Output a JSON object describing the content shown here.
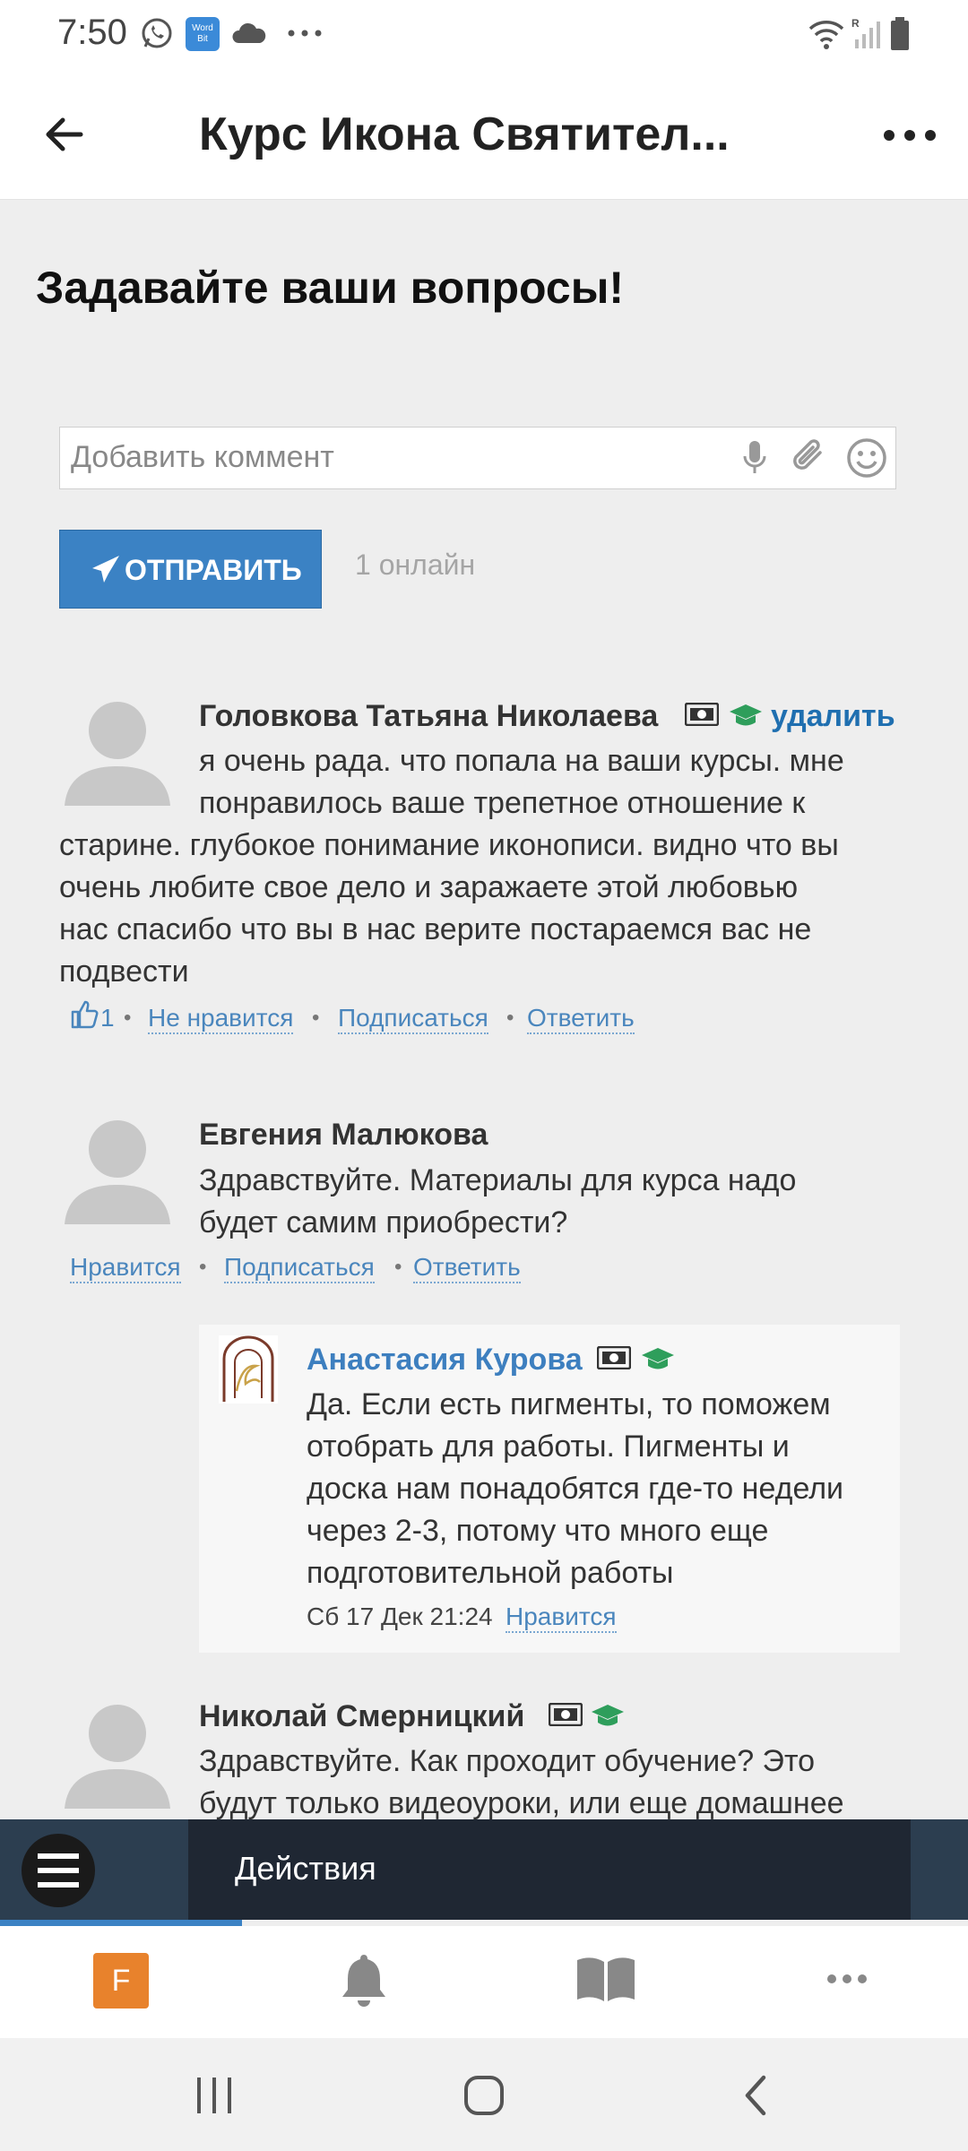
{
  "status_bar": {
    "time": "7:50",
    "icons": [
      "whatsapp-icon",
      "wordbit-icon",
      "cloud-icon",
      "more-dots-icon",
      "wifi-icon",
      "signal-icon",
      "battery-icon"
    ]
  },
  "header": {
    "title": "Курс Икона Святител...",
    "back_icon": "arrow-left-icon",
    "more_icon": "more-dots-icon"
  },
  "page": {
    "heading": "Задавайте ваши вопросы!",
    "comment_input_placeholder": "Добавить коммент",
    "send_label": "ОТПРАВИТЬ",
    "online": "1 онлайн"
  },
  "comments": [
    {
      "author": "Головкова Татьяна Николаева",
      "delete": "удалить",
      "text_lines": [
        "я очень рада. что попала на ваши курсы. мне",
        "понравилось ваше трепетное отношение к",
        "старине. глубокое понимание иконописи. видно что вы",
        "очень любите свое дело и заражаете этой любовью",
        "нас спасибо что вы в нас верите постараемся вас не",
        "подвести"
      ],
      "likes": "1",
      "dislike": "Не нравится",
      "subscribe": "Подписаться",
      "reply": "Ответить"
    },
    {
      "author": "Евгения Малюкова",
      "text_lines": [
        "Здравствуйте. Материалы для курса надо",
        "будет самим приобрести?"
      ],
      "like": "Нравится",
      "subscribe": "Подписаться",
      "reply": "Ответить"
    },
    {
      "author": "Николай Смерницкий",
      "text_lines": [
        "Здравствуйте. Как проходит обучение? Это",
        "будут только видеоуроки, или еще домашнее"
      ]
    }
  ],
  "reply": {
    "author": "Анастасия Курова",
    "text_lines": [
      "Да. Если есть пигменты, то поможем",
      "отобрать для работы. Пигменты и",
      "доска нам понадобятся где-то недели",
      "через 2-3, потому что много еще",
      "подготовительной работы"
    ],
    "date": "Сб 17 Дек 21:24",
    "like": "Нравится"
  },
  "action_bar": {
    "label": "Действия"
  },
  "bottom_nav": {
    "avatar_letter": "F",
    "items": [
      "profile-avatar",
      "bell-icon",
      "book-icon",
      "more-dots-icon"
    ]
  },
  "colors": {
    "accent": "#3b82c4",
    "link": "#4a86bd",
    "badge_green": "#2e9e5b",
    "action_bar": "#1f2733",
    "avatar_orange": "#e8822c"
  }
}
